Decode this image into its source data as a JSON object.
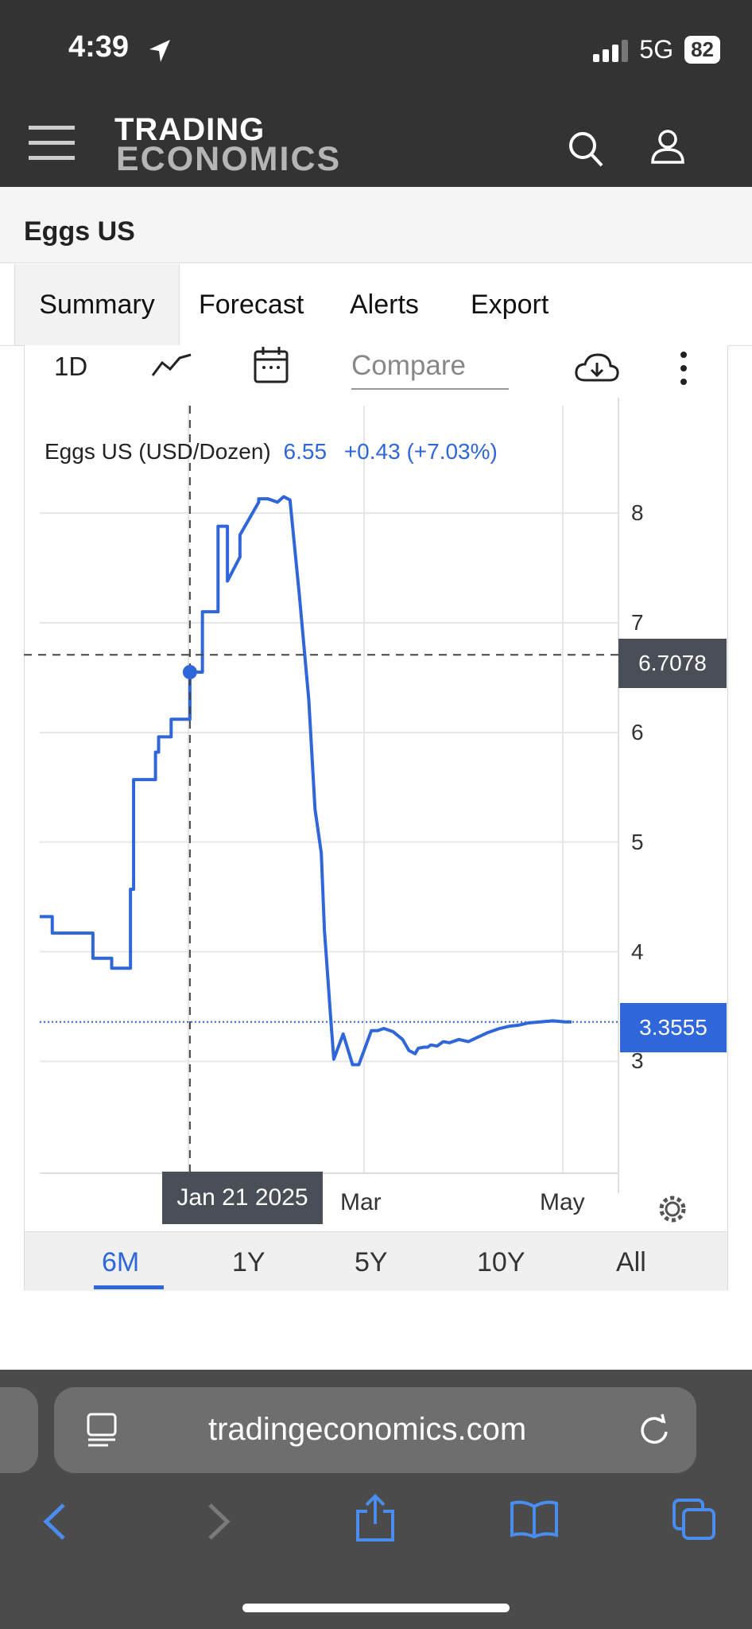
{
  "status_bar": {
    "time": "4:39",
    "network": "5G",
    "battery": "82"
  },
  "header": {
    "logo_line1": "TRADING",
    "logo_line2": "ECONOMICS"
  },
  "page": {
    "title": "Eggs US"
  },
  "tabs": [
    {
      "label": "Summary"
    },
    {
      "label": "Forecast"
    },
    {
      "label": "Alerts"
    },
    {
      "label": "Export"
    }
  ],
  "chart_toolbar": {
    "range_label": "1D",
    "compare_placeholder": "Compare"
  },
  "legend": {
    "name": "Eggs US (USD/Dozen)",
    "value": "6.55",
    "change": "+0.43 (+7.03%)"
  },
  "crosshair": {
    "value_label": "6.7078",
    "date_label": "Jan 21 2025"
  },
  "last_value_label": "3.3555",
  "range_buttons": [
    {
      "label": "6M"
    },
    {
      "label": "1Y"
    },
    {
      "label": "5Y"
    },
    {
      "label": "10Y"
    },
    {
      "label": "All"
    }
  ],
  "browser": {
    "url": "tradingeconomics.com"
  },
  "colors": {
    "line": "#2f66d9",
    "header_bg": "#333333",
    "label_bg": "#4a4f57"
  },
  "chart_data": {
    "type": "line",
    "title": "Eggs US (USD/Dozen)",
    "x_tick_labels": [
      "Mar",
      "May"
    ],
    "y_ticks": [
      3,
      4,
      5,
      6,
      7,
      8
    ],
    "ylim": [
      1.98,
      8.98
    ],
    "xlim": [
      0,
      185
    ],
    "grid": true,
    "series": [
      {
        "name": "Eggs US",
        "x": [
          0,
          4,
          4,
          17,
          17,
          23,
          23,
          29,
          29,
          30,
          30,
          37,
          37,
          38,
          38,
          42,
          42,
          48,
          48,
          52,
          52,
          57,
          57,
          59,
          60,
          60,
          64,
          64,
          70,
          70,
          73,
          76,
          78,
          80,
          83,
          86,
          88,
          90,
          91,
          93,
          94,
          97,
          100,
          102,
          106,
          108,
          110,
          113,
          116,
          118,
          120,
          121,
          123,
          124,
          125,
          127,
          129,
          131,
          134,
          137,
          140,
          143,
          145,
          147,
          150,
          153,
          156,
          160,
          164,
          168,
          170
        ],
        "y": [
          4.32,
          4.32,
          4.17,
          4.17,
          3.94,
          3.94,
          3.85,
          3.85,
          4.57,
          4.57,
          5.57,
          5.57,
          5.82,
          5.82,
          5.96,
          5.96,
          6.12,
          6.12,
          6.55,
          6.55,
          7.1,
          7.1,
          7.88,
          7.88,
          7.88,
          7.38,
          7.6,
          7.8,
          8.1,
          8.13,
          8.13,
          8.1,
          8.15,
          8.12,
          7.25,
          6.3,
          5.3,
          4.9,
          4.2,
          3.4,
          3.02,
          3.25,
          2.97,
          2.97,
          3.28,
          3.28,
          3.3,
          3.27,
          3.2,
          3.1,
          3.07,
          3.12,
          3.13,
          3.13,
          3.15,
          3.14,
          3.18,
          3.17,
          3.2,
          3.18,
          3.22,
          3.26,
          3.28,
          3.3,
          3.32,
          3.33,
          3.35,
          3.36,
          3.37,
          3.36,
          3.36
        ]
      }
    ]
  }
}
